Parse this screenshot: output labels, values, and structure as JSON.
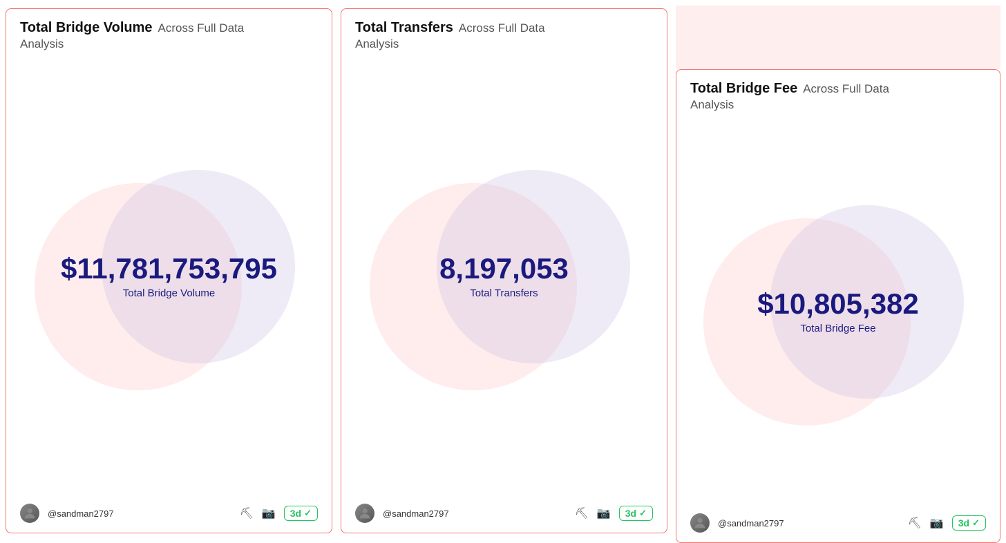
{
  "cards": [
    {
      "id": "bridge-volume",
      "title_bold": "Total Bridge Volume",
      "title_light": "Across Full Data",
      "title_second_line": "Analysis",
      "value": "$11,781,753,795",
      "value_label": "Total Bridge Volume",
      "username": "@sandman2797",
      "badge": "3d",
      "footer_icons": [
        "fork-icon",
        "camera-icon"
      ]
    },
    {
      "id": "total-transfers",
      "title_bold": "Total Transfers",
      "title_light": "Across Full Data",
      "title_second_line": "Analysis",
      "value": "8,197,053",
      "value_label": "Total Transfers",
      "username": "@sandman2797",
      "badge": "3d",
      "footer_icons": [
        "fork-icon",
        "camera-icon"
      ]
    },
    {
      "id": "bridge-fee",
      "title_bold": "Total Bridge Fee",
      "title_light": "Across Full Data",
      "title_second_line": "Analysis",
      "value": "$10,805,382",
      "value_label": "Total Bridge Fee",
      "username": "@sandman2797",
      "badge": "3d",
      "footer_icons": [
        "fork-icon",
        "camera-icon"
      ]
    }
  ]
}
